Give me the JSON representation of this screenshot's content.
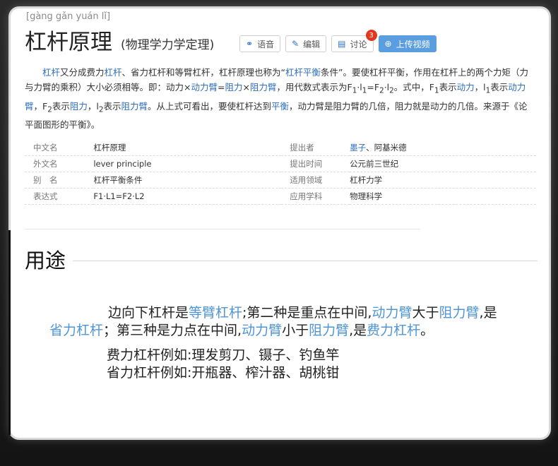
{
  "pinyin": "[gàng gǎn yuán lǐ]",
  "title": "杠杆原理",
  "subtitle": "(物理学力学定理)",
  "buttons": {
    "voice": "语音",
    "edit": "编辑",
    "discuss": "讨论",
    "discuss_count": "3",
    "upload": "上传视频"
  },
  "icons": {
    "voice": "headphones-icon",
    "edit": "pencil-icon",
    "discuss": "chat-icon",
    "upload": "plus-circle-icon"
  },
  "intro": {
    "p1": "杠杆",
    "p2": "又分成费力",
    "p3": "杠杆",
    "p4": "、省力杠杆和等臂杠杆，杠杆原理也称为“",
    "p5": "杠杆平衡",
    "p6": "条件”。要使杠杆平衡，作用在杠杆上的两个力矩（力与力臂的乘积）大小必须相等。即：动力×",
    "p7": "动力臂",
    "p8": "=",
    "p9": "阻力",
    "p10": "×",
    "p11": "阻力臂",
    "p12": "，用代数式表示为F",
    "p13": "1",
    "p14": "·l",
    "p15": "1",
    "p16": "=F",
    "p17": "2",
    "p18": "·l",
    "p19": "2",
    "p20": "。式中，F",
    "p21": "1",
    "p22": "表示",
    "p23": "动力",
    "p24": "，l",
    "p25": "1",
    "p26": "表示",
    "p27": "动力臂",
    "p28": "，F",
    "p29": "2",
    "p30": "表示",
    "p31": "阻力",
    "p32": "，l",
    "p33": "2",
    "p34": "表示",
    "p35": "阻力臂",
    "p36": "。从上式可看出，要使杠杆达到",
    "p37": "平衡",
    "p38": "，动力臂是阻力臂的几倍，阻力就是动力的几倍。来源于《论平面图形的平衡》。"
  },
  "info_rows": [
    {
      "k1": "中文名",
      "v1": "杠杆原理",
      "k2": "提出者",
      "v2a": "墨子",
      "v2b": "、阿基米德"
    },
    {
      "k1": "外文名",
      "v1": "lever principle",
      "k2": "提出时间",
      "v2a": "",
      "v2b": "公元前三世纪"
    },
    {
      "k1": "别　名",
      "v1": "杠杆平衡条件",
      "k2": "适用领域",
      "v2a": "",
      "v2b": "杠杆力学"
    },
    {
      "k1": "表达式",
      "v1": "F1·L1=F2·L2",
      "k2": "应用学科",
      "v2a": "",
      "v2b": "物理科学"
    }
  ],
  "section": {
    "title": "用途",
    "l1a": "边向下杠杆是",
    "l1b": "等臂杠杆",
    "l1c": ";第二种是重点在中间,",
    "l1d": "动力臂",
    "l1e": "大于",
    "l1f": "阻力臂",
    "l1g": ",是",
    "l2a": "省力杠杆",
    "l2b": "；第三种是力点在中间,",
    "l2c": "动力臂",
    "l2d": "小于",
    "l2e": "阻力臂",
    "l2f": ",是",
    "l2g": "费力杠杆",
    "l2h": "。",
    "ex1": "费力杠杆例如:理发剪刀、镊子、钓鱼竿",
    "ex2": "省力杠杆例如:开瓶器、榨汁器、胡桃钳"
  }
}
